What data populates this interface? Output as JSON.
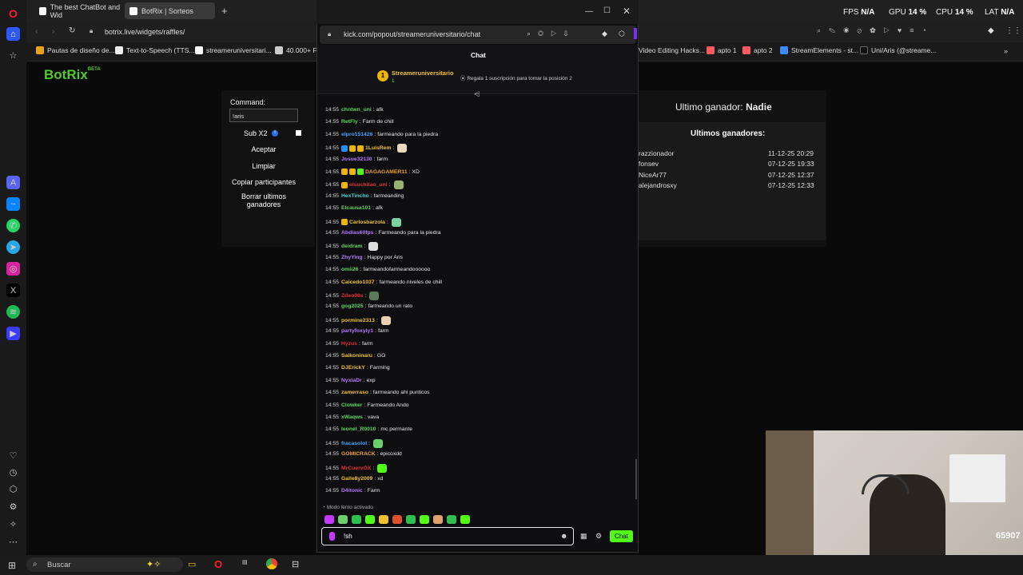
{
  "tabs": [
    {
      "label": "The best ChatBot and Wid"
    },
    {
      "label": "BotRix | Sorteos"
    }
  ],
  "stats": {
    "fps_label": "FPS",
    "fps": "N/A",
    "gpu_label": "GPU",
    "gpu": "14 %",
    "cpu_label": "CPU",
    "cpu": "14 %",
    "lat_label": "LAT",
    "lat": "N/A"
  },
  "address": "botrix.live/widgets/raffles/",
  "bookmarks": [
    "Pautas de diseño de...",
    "Text-to-Speech (TTS...",
    "streameruniversitari...",
    "40.000+ Fo",
    "Video Editing Hacks...",
    "apto 1",
    "apto 2",
    "StreamElements - st...",
    "Uni/Aris (@streame..."
  ],
  "botrix": {
    "logo": "BotRix",
    "beta": "BETA",
    "command_label": "Command:",
    "command_value": "!aris",
    "sub_label": "Sub X2",
    "buttons": [
      "Aceptar",
      "Limpiar",
      "Copiar participantes",
      "Borrar ultimos",
      "ganadores"
    ],
    "last_winner_label": "Ultimo ganador:",
    "last_winner": "Nadie",
    "winners_title": "Ultimos ganadores:",
    "winners": [
      {
        "name": "razzionador",
        "date": "11-12-25 20:29"
      },
      {
        "name": "fonsev",
        "date": "07-12-25 19:33"
      },
      {
        "name": "NiceAr77",
        "date": "07-12-25 12:37"
      },
      {
        "name": "alejandrosxy",
        "date": "07-12-25 12:33"
      }
    ]
  },
  "kick": {
    "url": "kick.com/popout/streameruniversitario/chat",
    "title": "Chat",
    "pinned_user": "Streameruniversitario",
    "pinned_rank": "1",
    "pinned_note": "Regala 1 suscripción para tomar la posición 2",
    "slow_mode": "Modo lento activado",
    "input_value": "!sh",
    "chat_button": "Chat",
    "messages": [
      {
        "time": "14:55",
        "user": "chntwn_uni",
        "text": "afk",
        "color": "#5fd45f"
      },
      {
        "time": "14:55",
        "user": "RetFly",
        "text": "Farm de chill",
        "color": "#5fd45f"
      },
      {
        "time": "14:55",
        "user": "elpro151426",
        "text": "farmeando para la piedra",
        "color": "#3ea7ff"
      },
      {
        "time": "14:55",
        "user": "1LuisRem",
        "text": "",
        "color": "#f0c030"
      },
      {
        "time": "14:55",
        "user": "Josue32130",
        "text": "farm",
        "color": "#b47aff"
      },
      {
        "time": "14:55",
        "user": "DAGAGAMER11",
        "text": "XD",
        "color": "#f0a030"
      },
      {
        "time": "14:55",
        "user": "elsuchitao_uni",
        "text": "",
        "color": "#e03030"
      },
      {
        "time": "14:55",
        "user": "HexTincho",
        "text": "farmeanding",
        "color": "#4ad6d6"
      },
      {
        "time": "14:55",
        "user": "Elcausa101",
        "text": "afk",
        "color": "#5fd45f"
      },
      {
        "time": "14:55",
        "user": "Carlosbarzola",
        "text": "",
        "color": "#f0c030"
      },
      {
        "time": "14:55",
        "user": "Abdias60fps",
        "text": "Farmeando para la piedra",
        "color": "#b47aff"
      },
      {
        "time": "14:55",
        "user": "deidram",
        "text": "",
        "color": "#5fd45f"
      },
      {
        "time": "14:55",
        "user": "ZhyYing",
        "text": "Happy por Aris",
        "color": "#b47aff"
      },
      {
        "time": "14:55",
        "user": "omii26",
        "text": "farmeandofarmeandoooooo",
        "color": "#5fd45f"
      },
      {
        "time": "14:55",
        "user": "Caicedo1037",
        "text": "farmeando niveles de chill",
        "color": "#f0c030"
      },
      {
        "time": "14:55",
        "user": "Zdeo06s",
        "text": "",
        "color": "#e03030"
      },
      {
        "time": "14:55",
        "user": "gog2025",
        "text": "farmeando un rato",
        "color": "#5fd45f"
      },
      {
        "time": "14:55",
        "user": "pormine2313",
        "text": "",
        "color": "#f0c030"
      },
      {
        "time": "14:55",
        "user": "partyfoxyly1",
        "text": "farm",
        "color": "#b47aff"
      },
      {
        "time": "14:55",
        "user": "Hyzus",
        "text": "farm",
        "color": "#e03030"
      },
      {
        "time": "14:55",
        "user": "Saikoninaru",
        "text": "GG",
        "color": "#f0c030"
      },
      {
        "time": "14:55",
        "user": "DJErickY",
        "text": "Farming",
        "color": "#f0c030"
      },
      {
        "time": "14:55",
        "user": "NyxiaDr",
        "text": "exp",
        "color": "#b47aff"
      },
      {
        "time": "14:55",
        "user": "zamerraso",
        "text": "farmeando ahi punticos",
        "color": "#f0c030"
      },
      {
        "time": "14:55",
        "user": "Clowker",
        "text": "Farmeando Ando",
        "color": "#5fd45f"
      },
      {
        "time": "14:55",
        "user": "xWaqws",
        "text": "vava",
        "color": "#5fd45f"
      },
      {
        "time": "14:55",
        "user": "leonel_R0010",
        "text": "mc permante",
        "color": "#5fd45f"
      },
      {
        "time": "14:55",
        "user": "fracasolol",
        "text": "",
        "color": "#3ea7ff"
      },
      {
        "time": "14:55",
        "user": "GOMICRACK",
        "text": "epicoxdd",
        "color": "#f0a030"
      },
      {
        "time": "14:55",
        "user": "MrCuervOX",
        "text": "",
        "color": "#e03030"
      },
      {
        "time": "14:55",
        "user": "Galle8y2009",
        "text": "xd",
        "color": "#f0c030"
      },
      {
        "time": "14:55",
        "user": "D4itonic",
        "text": "Farm",
        "color": "#b47aff"
      }
    ]
  },
  "taskbar": {
    "search": "Buscar"
  },
  "webcam": {
    "overlay": "65907"
  }
}
